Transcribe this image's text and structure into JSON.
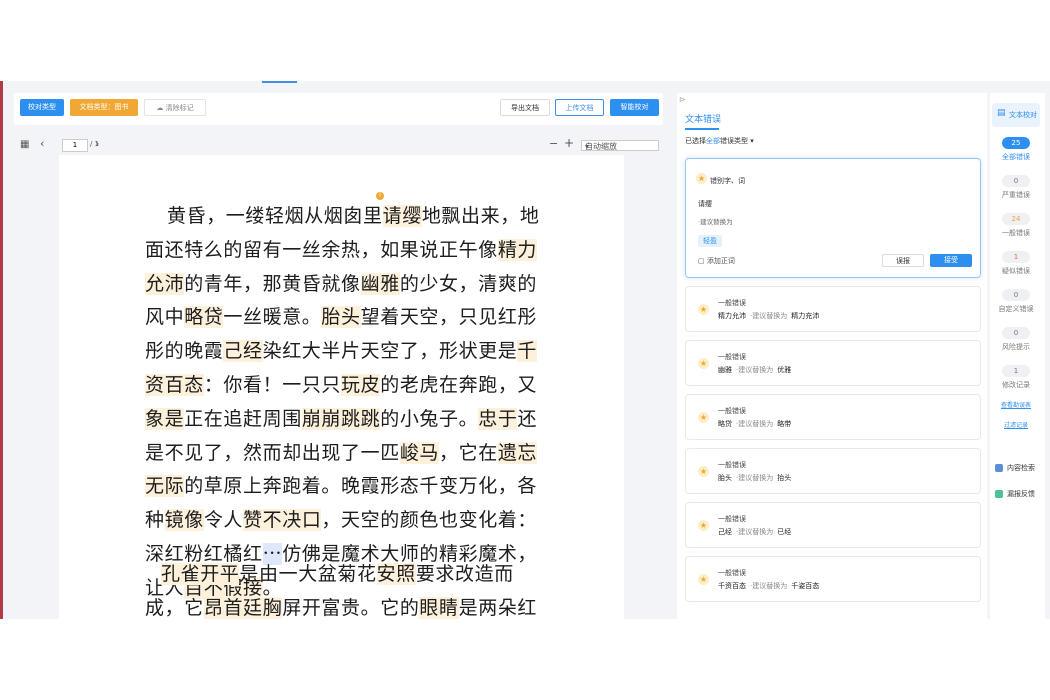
{
  "toolbar": {
    "proof_type": "校对类型",
    "doc_type": "文档类型：图书",
    "clear_marks": "清除标记",
    "export_doc": "导出文档",
    "upload_doc": "上传文档",
    "smart_proof": "智能校对"
  },
  "pager": {
    "grid_icon": "grid-icon",
    "prev": "‹",
    "page": "1",
    "total": "/ 1",
    "next": "›",
    "zoom_out": "−",
    "zoom_in": "+",
    "zoom": "自动缩放"
  },
  "document": {
    "marker": "!",
    "paragraphs": [
      [
        {
          "t": "黄昏，一缕轻烟从烟囱里"
        },
        {
          "t": "请缨",
          "h": 1
        },
        {
          "t": "地飘出来，地面还特么的留有一丝余热，如果说正午像"
        },
        {
          "t": "精力允沛",
          "h": 1
        },
        {
          "t": "的青年，那黄昏就像"
        },
        {
          "t": "幽雅",
          "h": 1
        },
        {
          "t": "的少女，清爽的风中"
        },
        {
          "t": "略贷",
          "h": 1
        },
        {
          "t": "一丝暖意。"
        },
        {
          "t": "胎头",
          "h": 1
        },
        {
          "t": "望着天空，只见红彤彤的晚霞"
        },
        {
          "t": "己经",
          "h": 1
        },
        {
          "t": "染红大半片天空了，形状更是"
        },
        {
          "t": "千资百态",
          "h": 1
        },
        {
          "t": "：你看！一只只"
        },
        {
          "t": "玩皮",
          "h": 1
        },
        {
          "t": "的老虎在奔跑，又"
        },
        {
          "t": "象是",
          "h": 1
        },
        {
          "t": "正在追赶周围"
        },
        {
          "t": "崩崩跳跳",
          "h": 1
        },
        {
          "t": "的小兔子。"
        },
        {
          "t": "忠于",
          "h": 1
        },
        {
          "t": "还是不见了，然而却出现了一匹"
        },
        {
          "t": "峻马",
          "h": 1
        },
        {
          "t": "，它在"
        },
        {
          "t": "遗忘无际",
          "h": 1
        },
        {
          "t": "的草原上奔跑着。晚霞形态千变万化，各种"
        },
        {
          "t": "镜像",
          "h": 1
        },
        {
          "t": "令人"
        },
        {
          "t": "赞不决口",
          "h": 1
        },
        {
          "t": "，天空的颜色也变化着：深红粉红橘红"
        },
        {
          "t": "⋯",
          "h": 2
        },
        {
          "t": "仿佛是魔术大师的精彩魔术，让人"
        },
        {
          "t": "目不假接",
          "h": 1
        },
        {
          "t": "。"
        }
      ],
      [
        {
          "t": "孔雀开平",
          "h": 1
        },
        {
          "t": "是由一大盆菊花"
        },
        {
          "t": "安照",
          "h": 1
        },
        {
          "t": "要求改造而成，它"
        },
        {
          "t": "昂首廷胸",
          "h": 1
        },
        {
          "t": "屏开富贵。它的"
        },
        {
          "t": "眼睛",
          "h": 1
        },
        {
          "t": "是两朵红"
        }
      ]
    ]
  },
  "panel": {
    "title": "文本错误",
    "filter_prefix": "已选择",
    "filter_all": "全部",
    "filter_suffix": "错误类型 ▾",
    "active_card": {
      "type": "错别字、词",
      "word": "请缨",
      "suggest": "·建议替换为",
      "tag": "轻盈",
      "add": "添加正词",
      "misreport": "误报",
      "accept": "接受"
    },
    "cards": [
      {
        "level": "一般错误",
        "from": "精力允沛",
        "label": "·建议替换为",
        "to": "精力充沛"
      },
      {
        "level": "一般错误",
        "from": "幽雅",
        "label": "·建议替换为",
        "to": "优雅"
      },
      {
        "level": "一般错误",
        "from": "略贷",
        "label": "·建议替换为",
        "to": "略带"
      },
      {
        "level": "一般错误",
        "from": "胎头",
        "label": "·建议替换为",
        "to": "抬头"
      },
      {
        "level": "一般错误",
        "from": "己经",
        "label": "·建议替换为",
        "to": "已经"
      },
      {
        "level": "一般错误",
        "from": "千资百态",
        "label": "·建议替换为",
        "to": "千姿百态"
      }
    ]
  },
  "sidebar": {
    "top": "文本校对",
    "counts": [
      {
        "n": "25",
        "label": "全部错误"
      },
      {
        "n": "0",
        "label": "严重错误"
      },
      {
        "n": "24",
        "label": "一般错误"
      },
      {
        "n": "1",
        "label": "疑似错误"
      },
      {
        "n": "0",
        "label": "自定义错误"
      },
      {
        "n": "0",
        "label": "风险提示"
      },
      {
        "n": "1",
        "label": "修改记录"
      }
    ],
    "link_report": "查看勘误表",
    "link_filter": "过滤记录",
    "content_search": "内容检索",
    "feedback": "漏报反馈"
  },
  "colors": {
    "accent": "#2d8ff0",
    "highlight": "#fdf1db",
    "warning": "#f0a734"
  }
}
